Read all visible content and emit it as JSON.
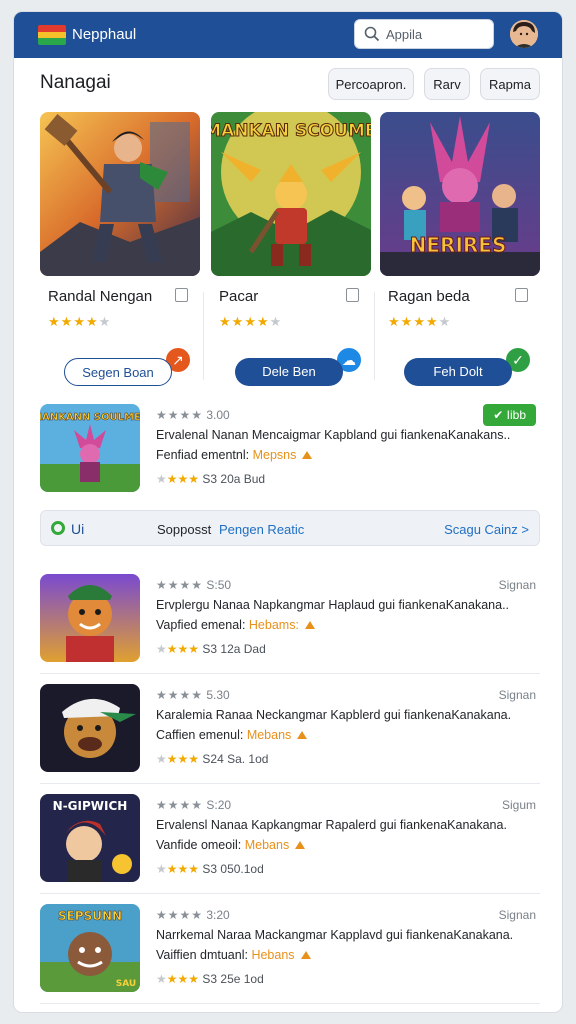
{
  "header": {
    "brand": "Nepphaul",
    "search_placeholder": "Appila",
    "flag_colors": [
      "#e23a2c",
      "#f4c12b",
      "#2aa74a"
    ],
    "accent": "#1f4f96"
  },
  "section": {
    "title": "Nanagai",
    "chips": [
      "Percoapron.",
      "Rarv",
      "Rapma"
    ]
  },
  "featured": [
    {
      "name": "Randal Nengan",
      "art_title": "",
      "rating": 4,
      "button": "Segen Boan",
      "style": "outline",
      "badge_color": "#e4571d",
      "badge_icon": "↗"
    },
    {
      "name": "Pacar",
      "art_title": "MANKAN SCOUMB",
      "rating": 4,
      "button": "Dele Ben",
      "style": "filled",
      "badge_color": "#1e88e5",
      "badge_icon": "☁"
    },
    {
      "name": "Ragan beda",
      "art_title": "NERIRES",
      "rating": 4,
      "button": "Feh Dolt",
      "style": "filled",
      "badge_color": "#2ea043",
      "badge_icon": "✓"
    }
  ],
  "list_top": {
    "art_title": "MANKANN SOULMES",
    "rating_text": "3.00",
    "pill": "Iibb",
    "desc": "Ervalenal Nanan Mencaigmar Kapbland gui fiankenaKanakans..",
    "ver_label": "Fenfiad ementnl:",
    "ver_value": "Mepsns",
    "meta": "S3 20a Bud"
  },
  "banner": {
    "left": "Ui",
    "middle": "Sopposst",
    "link": "Pengen Reatic",
    "right": "Scagu Cainz",
    "chevron": ">"
  },
  "list": [
    {
      "rating_text": "S:50",
      "right": "Signan",
      "desc": "Ervplergu Nanaa Napkangmar Haplaud gui fiankenaKanakana..",
      "ver_label": "Vapfied emenal:",
      "ver_value": "Hebams:",
      "meta": "S3 12a Dad",
      "art_title": ""
    },
    {
      "rating_text": "5.30",
      "right": "Signan",
      "desc": "Karalemia Ranaa Neckangmar Kapblerd gui fiankenaKanakana.",
      "ver_label": "Caffien emenul:",
      "ver_value": "Mebans",
      "meta": "S24 Sa. 1od",
      "art_title": ""
    },
    {
      "rating_text": "S:20",
      "right": "Sigum",
      "desc": "Ervalensl Nanaa Kapkangmar Rapalerd gui fiankenaKanakana.",
      "ver_label": "Vanfide omeoil:",
      "ver_value": "Mebans",
      "meta": "S3 050.1od",
      "art_title": "N-GIPWICH"
    },
    {
      "rating_text": "3:20",
      "right": "Signan",
      "desc": "Narrkemal Naraa Mackangmar Kapplavd gui fiankenaKanakana.",
      "ver_label": "Vaiffien dmtuanl:",
      "ver_value": "Hebans",
      "meta": "S3 25e 1od",
      "art_title": "SEPSUNN",
      "art_corner": "SAU"
    }
  ]
}
